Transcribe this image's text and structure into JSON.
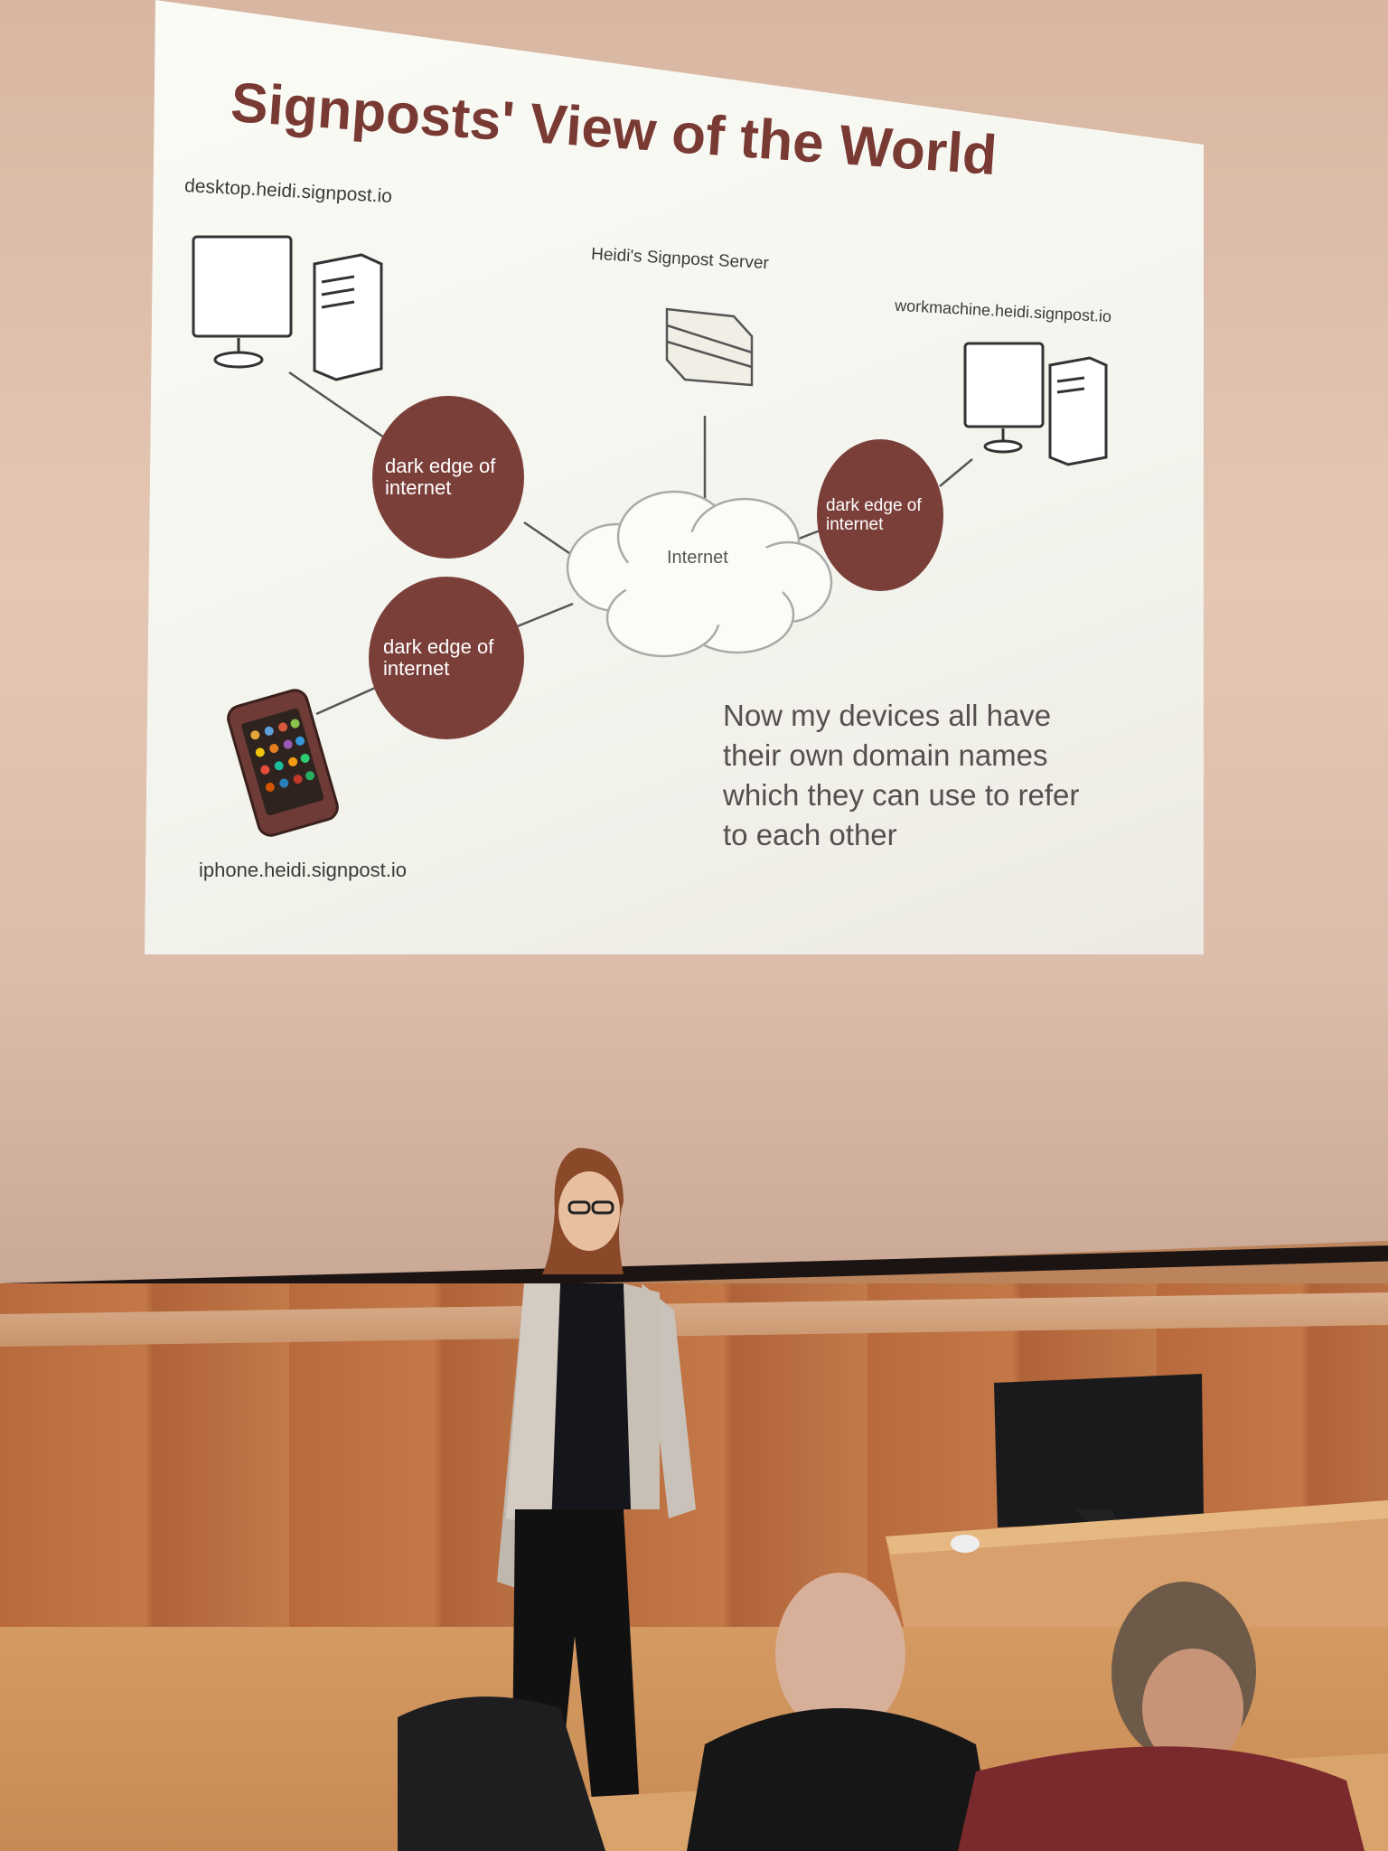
{
  "slide": {
    "title": "Signposts' View of the World",
    "labels": {
      "desktop": "desktop.heidi.signpost.io",
      "server": "Heidi's Signpost Server",
      "workmachine": "workmachine.heidi.signpost.io",
      "iphone": "iphone.heidi.signpost.io",
      "internet": "Internet"
    },
    "circles": [
      {
        "line1": "dark edge of",
        "line2": "internet"
      },
      {
        "line1": "dark edge of",
        "line2": "internet"
      },
      {
        "line1": "dark edge of",
        "line2": "internet"
      }
    ],
    "body_text": [
      "Now my devices all have",
      "their own domain names",
      "which they can use to refer",
      "to each other"
    ]
  },
  "colors": {
    "slide_accent": "#7b3f3a",
    "title": "#7a3a34",
    "wall_wood": "#c47848"
  },
  "icons": [
    "desktop-computer-icon",
    "server-icon",
    "workstation-icon",
    "smartphone-icon",
    "cloud-icon"
  ]
}
